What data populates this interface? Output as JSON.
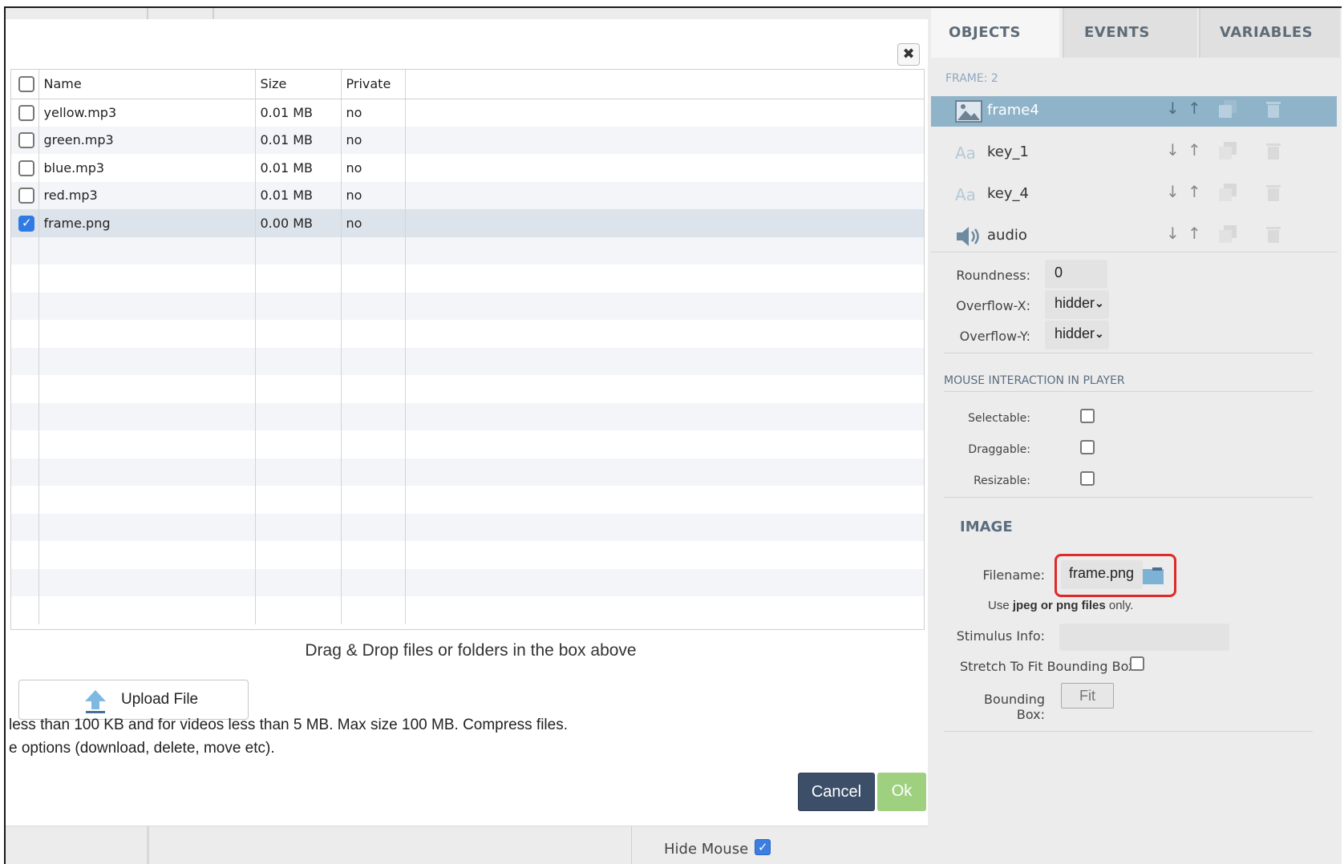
{
  "modal": {
    "close_glyph": "✖",
    "table": {
      "headers": [
        "",
        "Name",
        "Size",
        "Private",
        ""
      ],
      "rows": [
        {
          "name": "yellow.mp3",
          "size": "0.01 MB",
          "private": "no",
          "checked": false
        },
        {
          "name": "green.mp3",
          "size": "0.01 MB",
          "private": "no",
          "checked": false
        },
        {
          "name": "blue.mp3",
          "size": "0.01 MB",
          "private": "no",
          "checked": false
        },
        {
          "name": "red.mp3",
          "size": "0.01 MB",
          "private": "no",
          "checked": false
        },
        {
          "name": "frame.png",
          "size": "0.00 MB",
          "private": "no",
          "checked": true
        }
      ]
    },
    "dnd_text": "Drag & Drop files or folders in the box above",
    "upload_label": "Upload File",
    "note_line1": "less than 100 KB and for videos less than 5 MB. Max size 100 MB. Compress files.",
    "note_line2": "e options (download, delete, move etc).",
    "cancel_label": "Cancel",
    "ok_label": "Ok"
  },
  "footer": {
    "hide_mouse_label": "Hide Mouse",
    "hide_mouse_checked": true
  },
  "right_panel": {
    "tabs": [
      "OBJECTS",
      "EVENTS",
      "VARIABLES"
    ],
    "frame_label": "FRAME: 2",
    "objects": [
      {
        "name": "frame4",
        "icon": "image-icon",
        "selected": true
      },
      {
        "name": "key_1",
        "icon": "text-icon",
        "selected": false
      },
      {
        "name": "key_4",
        "icon": "text-icon",
        "selected": false
      },
      {
        "name": "audio",
        "icon": "speaker-icon",
        "selected": false
      }
    ],
    "text_icon_glyph": "Aa",
    "arrow_down": "↓",
    "arrow_up": "↑",
    "properties": {
      "roundness_label": "Roundness:",
      "roundness_value": "0",
      "overflow_x_label": "Overflow-X:",
      "overflow_x_value": "hidder",
      "overflow_y_label": "Overflow-Y:",
      "overflow_y_value": "hidder"
    },
    "mouse_section": {
      "title": "MOUSE INTERACTION IN PLAYER",
      "selectable_label": "Selectable:",
      "draggable_label": "Draggable:",
      "resizable_label": "Resizable:"
    },
    "image_section": {
      "title": "IMAGE",
      "filename_label": "Filename:",
      "filename_value": "frame.png",
      "hint_prefix": "Use ",
      "hint_bold": "jpeg or png files",
      "hint_suffix": " only.",
      "stimulus_label": "Stimulus Info:",
      "stretch_label": "Stretch To Fit Bounding Box:",
      "bounding_label": "Bounding Box:",
      "fit_label": "Fit"
    }
  },
  "colors": {
    "selected_row": "#8fb3c8",
    "highlight_border": "#dd2b2b",
    "cancel_bg": "#3d4f68",
    "ok_bg": "#9fd07f",
    "checkbox_on": "#2f7ae5"
  }
}
